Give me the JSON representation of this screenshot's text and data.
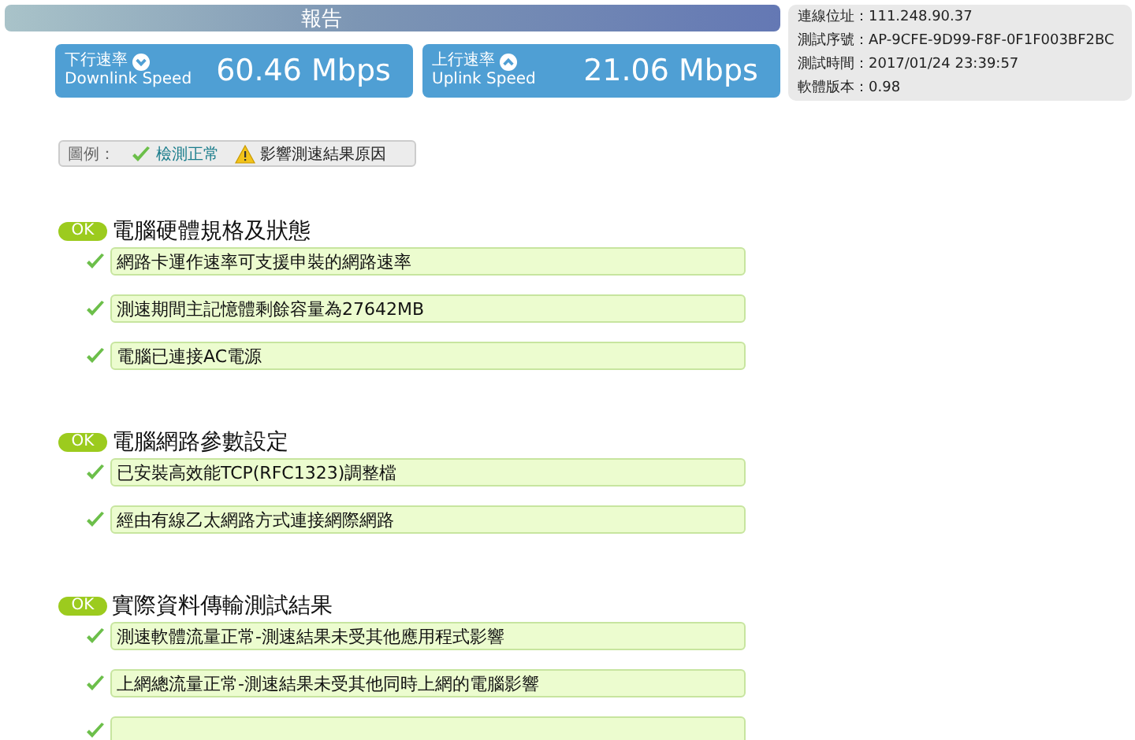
{
  "title_bar": {
    "title": "報告"
  },
  "speeds": [
    {
      "kind": "down",
      "label": "下行速率",
      "sublabel": "Downlink Speed",
      "value": "60.46 Mbps"
    },
    {
      "kind": "up",
      "label": "上行速率",
      "sublabel": "Uplink Speed",
      "value": "21.06 Mbps"
    }
  ],
  "info": [
    {
      "label": "連線位址：",
      "value": "111.248.90.37"
    },
    {
      "label": "測試序號：",
      "value": "AP-9CFE-9D99-F8F-0F1F003BF2BC"
    },
    {
      "label": "測試時間：",
      "value": "2017/01/24 23:39:57"
    },
    {
      "label": "軟體版本：",
      "value": "0.98"
    }
  ],
  "legend": {
    "label": "圖例：",
    "items": [
      {
        "kind": "ok",
        "text": "檢測正常"
      },
      {
        "kind": "warn",
        "text": "影響測速結果原因"
      }
    ]
  },
  "sections": [
    {
      "badge": "OK",
      "title": "電腦硬體規格及狀態",
      "rows": [
        {
          "kind": "ok",
          "text": "網路卡運作速率可支援申裝的網路速率"
        },
        {
          "kind": "ok",
          "text": "測速期間主記憶體剩餘容量為27642MB"
        },
        {
          "kind": "ok",
          "text": "電腦已連接AC電源"
        }
      ]
    },
    {
      "badge": "OK",
      "title": "電腦網路參數設定",
      "rows": [
        {
          "kind": "ok",
          "text": "已安裝高效能TCP(RFC1323)調整檔"
        },
        {
          "kind": "ok",
          "text": "經由有線乙太網路方式連接網際網路"
        }
      ]
    },
    {
      "badge": "OK",
      "title": "實際資料傳輸測試結果",
      "rows": [
        {
          "kind": "ok",
          "text": "測速軟體流量正常-測速結果未受其他應用程式影響"
        },
        {
          "kind": "ok",
          "text": "上網總流量正常-測速結果未受其他同時上網的電腦影響"
        },
        {
          "kind": "ok"
        }
      ]
    }
  ]
}
